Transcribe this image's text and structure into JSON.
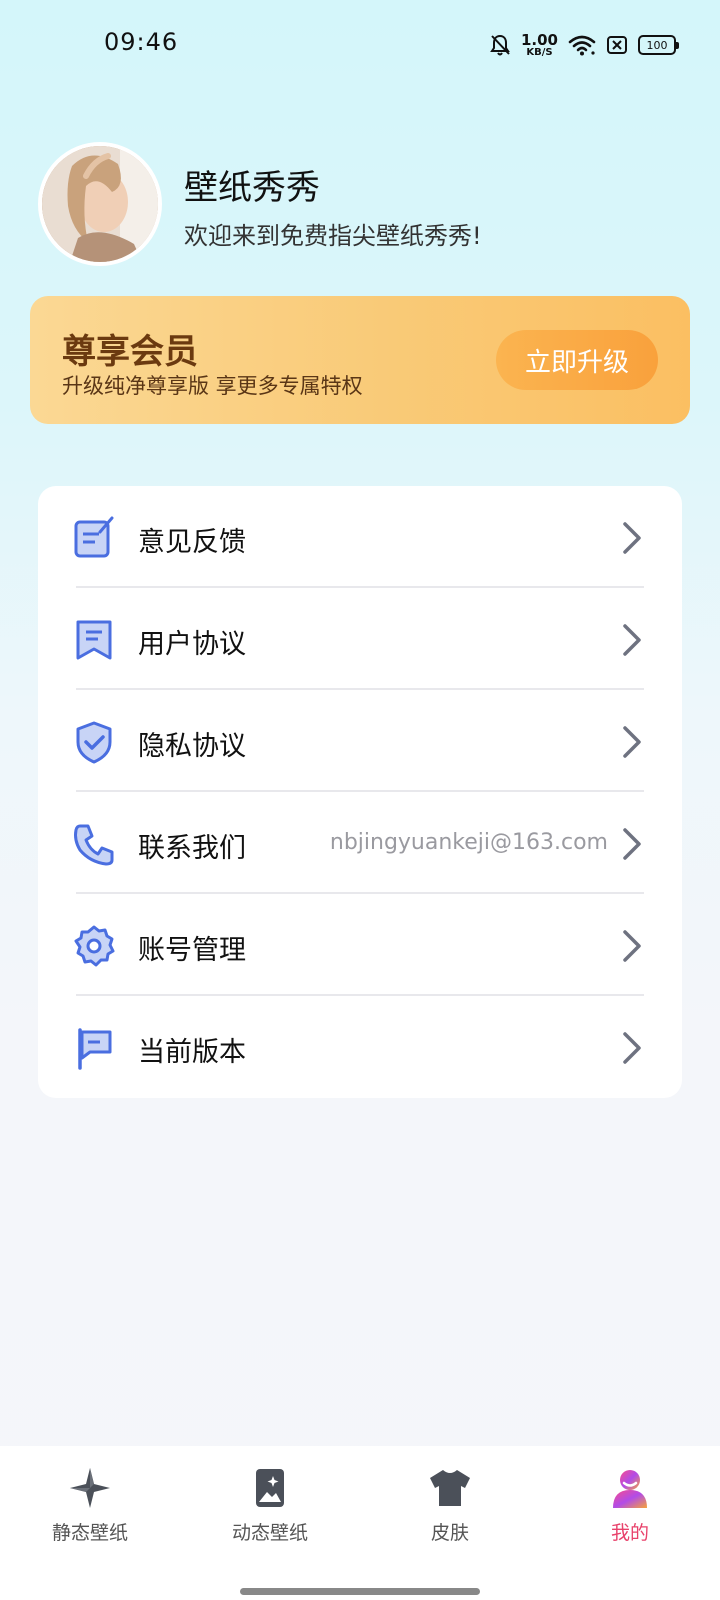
{
  "status_bar": {
    "time": "09:46",
    "speed_value": "1.00",
    "speed_unit": "KB/S",
    "battery": "100",
    "icons": [
      "mute-bell-icon",
      "wifi-icon",
      "sim-off-icon",
      "battery-icon"
    ]
  },
  "profile": {
    "name": "壁纸秀秀",
    "subtitle": "欢迎来到免费指尖壁纸秀秀!"
  },
  "vip": {
    "title": "尊享会员",
    "description": "升级纯净尊享版 享更多专属特权",
    "button_label": "立即升级"
  },
  "menu": {
    "items": [
      {
        "label": "意见反馈",
        "icon": "feedback-icon",
        "value": ""
      },
      {
        "label": "用户协议",
        "icon": "bookmark-document-icon",
        "value": ""
      },
      {
        "label": "隐私协议",
        "icon": "shield-check-icon",
        "value": ""
      },
      {
        "label": "联系我们",
        "icon": "phone-icon",
        "value": "nbjingyuankeji@163.com"
      },
      {
        "label": "账号管理",
        "icon": "gear-icon",
        "value": ""
      },
      {
        "label": "当前版本",
        "icon": "flag-icon",
        "value": ""
      }
    ]
  },
  "bottom_nav": {
    "items": [
      {
        "label": "静态壁纸",
        "icon": "static-wallpaper-icon",
        "active": false
      },
      {
        "label": "动态壁纸",
        "icon": "live-wallpaper-icon",
        "active": false
      },
      {
        "label": "皮肤",
        "icon": "tshirt-icon",
        "active": false
      },
      {
        "label": "我的",
        "icon": "profile-icon",
        "active": true
      }
    ]
  },
  "colors": {
    "accent": "#4a6ee0",
    "vip_gradient_start": "#fbd894",
    "vip_gradient_end": "#fbbf62",
    "nav_active": "#e8426b"
  }
}
